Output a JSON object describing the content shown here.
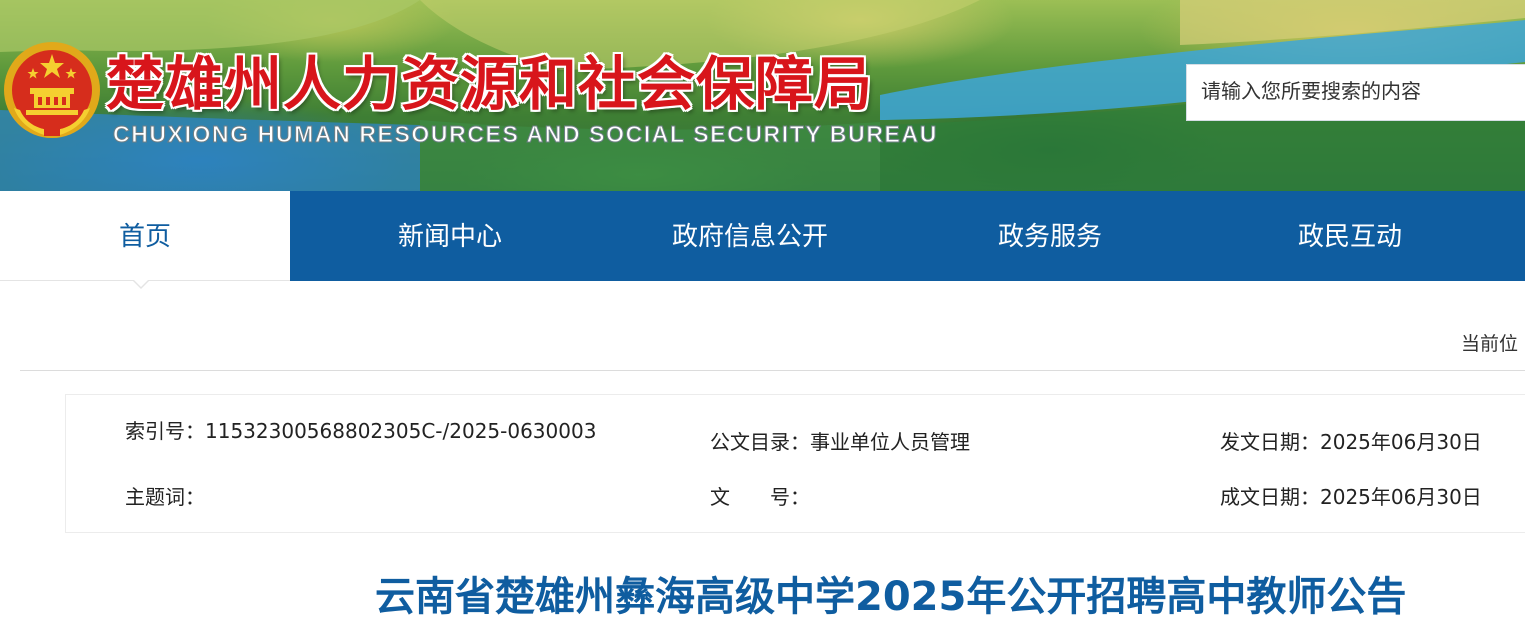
{
  "header": {
    "title": "楚雄州人力资源和社会保障局",
    "subtitle": "CHUXIONG HUMAN RESOURCES AND SOCIAL SECURITY BUREAU",
    "emblem_icon": "national-emblem-icon",
    "brand_red": "#d8151b"
  },
  "search": {
    "placeholder": "请输入您所要搜索的内容"
  },
  "nav": {
    "items": [
      {
        "label": "首页",
        "active": true
      },
      {
        "label": "新闻中心"
      },
      {
        "label": "政府信息公开"
      },
      {
        "label": "政务服务"
      },
      {
        "label": "政民互动"
      }
    ],
    "color": "#0f5da0"
  },
  "breadcrumb": {
    "text": "当前位"
  },
  "meta": {
    "index_label": "索引号：",
    "index_value": "11532300568802305C-/2025-0630003",
    "catalog_label": "公文目录：",
    "catalog_value": "事业单位人员管理",
    "issue_date_label": "发文日期：",
    "issue_date_value": "2025年06月30日",
    "subject_label": "主题词：",
    "subject_value": "",
    "doc_no_label": "文　　号：",
    "doc_no_value": "",
    "created_date_label": "成文日期：",
    "created_date_value": "2025年06月30日"
  },
  "article": {
    "title": "云南省楚雄州彝海高级中学2025年公开招聘高中教师公告"
  }
}
